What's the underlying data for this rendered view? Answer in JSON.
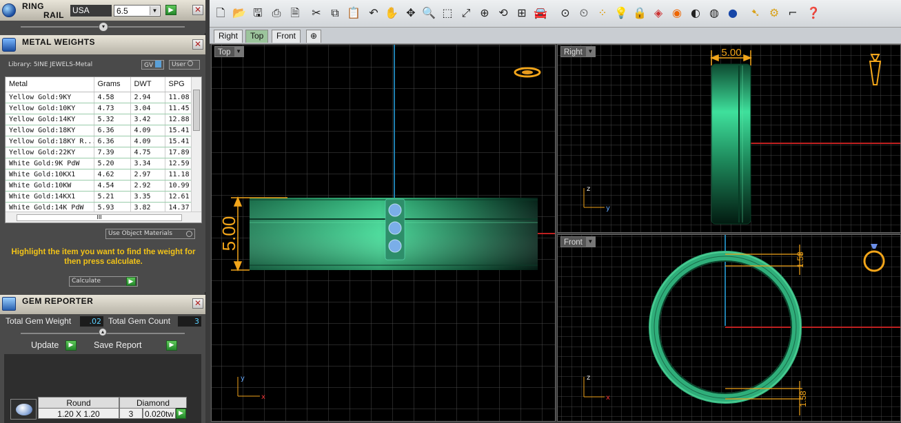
{
  "ring_rail": {
    "title_line1": "RING",
    "title_line2": "RAIL",
    "country": "USA",
    "ring_size": "6.5"
  },
  "metal_weights": {
    "title": "METAL WEIGHTS",
    "library": "Library: 5INE JEWELS-Metal",
    "toggle_gv": "GV",
    "toggle_user": "User",
    "columns": [
      "Metal",
      "Grams",
      "DWT",
      "SPG"
    ],
    "rows": [
      [
        "Yellow Gold:9KY",
        "4.58",
        "2.94",
        "11.08"
      ],
      [
        "Yellow Gold:10KY",
        "4.73",
        "3.04",
        "11.45"
      ],
      [
        "Yellow Gold:14KY",
        "5.32",
        "3.42",
        "12.88"
      ],
      [
        "Yellow Gold:18KY",
        "6.36",
        "4.09",
        "15.41"
      ],
      [
        "Yellow Gold:18KY R...",
        "6.36",
        "4.09",
        "15.41"
      ],
      [
        "Yellow Gold:22KY",
        "7.39",
        "4.75",
        "17.89"
      ],
      [
        "White Gold:9K PdW",
        "5.20",
        "3.34",
        "12.59"
      ],
      [
        "White Gold:10KX1",
        "4.62",
        "2.97",
        "11.18"
      ],
      [
        "White Gold:10KW",
        "4.54",
        "2.92",
        "10.99"
      ],
      [
        "White Gold:14KX1",
        "5.21",
        "3.35",
        "12.61"
      ],
      [
        "White Gold:14K PdW",
        "5.93",
        "3.82",
        "14.37"
      ]
    ],
    "use_object_materials": "Use Object Materials",
    "hint": "Highlight the item you want to find the weight for then press calculate.",
    "calculate_label": "Calculate"
  },
  "gem_reporter": {
    "title": "GEM REPORTER",
    "total_gem_weight_label": "Total Gem Weight",
    "total_gem_weight": ".02",
    "total_gem_count_label": "Total Gem Count",
    "total_gem_count": "3",
    "update_label": "Update",
    "save_report_label": "Save Report",
    "gem": {
      "shape": "Round",
      "type": "Diamond",
      "size": "1.20 X 1.20",
      "count": "3",
      "weight": "0.020tw"
    }
  },
  "tabs": [
    "Right",
    "Top",
    "Front"
  ],
  "viewports": {
    "top": {
      "label": "Top",
      "dimension": "5.00",
      "axis_x": "x",
      "axis_y": "y"
    },
    "right": {
      "label": "Right",
      "dimension": "5.00",
      "axis_x": "y",
      "axis_y": "z"
    },
    "front": {
      "label": "Front",
      "dimension_top": "1.58",
      "dimension_bottom": "1.58",
      "axis_x": "x",
      "axis_y": "z"
    }
  },
  "colors": {
    "ring_green": "#2fae7a",
    "dimension_orange": "#f2a51a",
    "axis_red": "#c02020",
    "axis_blue": "#1f7fae",
    "hint_yellow": "#f2c318"
  }
}
